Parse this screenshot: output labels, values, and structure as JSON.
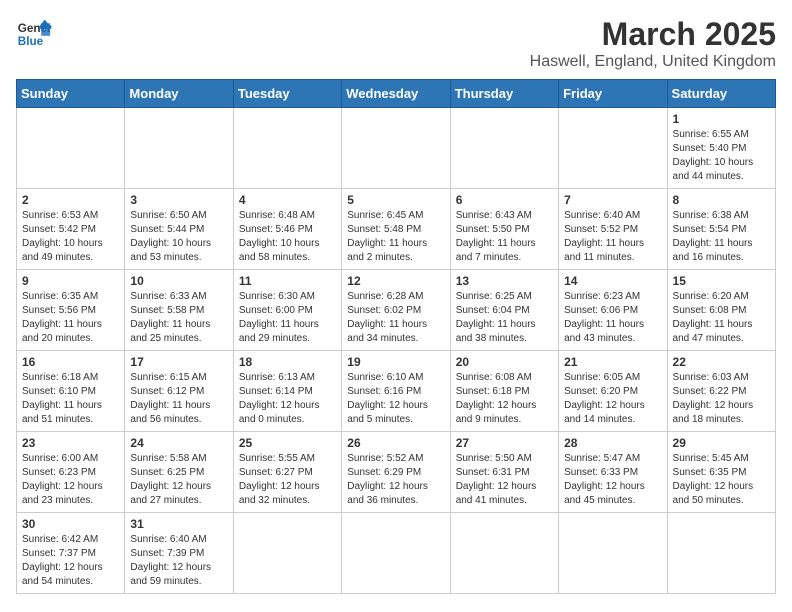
{
  "header": {
    "logo_line1": "General",
    "logo_line2": "Blue",
    "title": "March 2025",
    "subtitle": "Haswell, England, United Kingdom"
  },
  "weekdays": [
    "Sunday",
    "Monday",
    "Tuesday",
    "Wednesday",
    "Thursday",
    "Friday",
    "Saturday"
  ],
  "weeks": [
    [
      {
        "day": "",
        "info": ""
      },
      {
        "day": "",
        "info": ""
      },
      {
        "day": "",
        "info": ""
      },
      {
        "day": "",
        "info": ""
      },
      {
        "day": "",
        "info": ""
      },
      {
        "day": "",
        "info": ""
      },
      {
        "day": "1",
        "info": "Sunrise: 6:55 AM\nSunset: 5:40 PM\nDaylight: 10 hours\nand 44 minutes."
      }
    ],
    [
      {
        "day": "2",
        "info": "Sunrise: 6:53 AM\nSunset: 5:42 PM\nDaylight: 10 hours\nand 49 minutes."
      },
      {
        "day": "3",
        "info": "Sunrise: 6:50 AM\nSunset: 5:44 PM\nDaylight: 10 hours\nand 53 minutes."
      },
      {
        "day": "4",
        "info": "Sunrise: 6:48 AM\nSunset: 5:46 PM\nDaylight: 10 hours\nand 58 minutes."
      },
      {
        "day": "5",
        "info": "Sunrise: 6:45 AM\nSunset: 5:48 PM\nDaylight: 11 hours\nand 2 minutes."
      },
      {
        "day": "6",
        "info": "Sunrise: 6:43 AM\nSunset: 5:50 PM\nDaylight: 11 hours\nand 7 minutes."
      },
      {
        "day": "7",
        "info": "Sunrise: 6:40 AM\nSunset: 5:52 PM\nDaylight: 11 hours\nand 11 minutes."
      },
      {
        "day": "8",
        "info": "Sunrise: 6:38 AM\nSunset: 5:54 PM\nDaylight: 11 hours\nand 16 minutes."
      }
    ],
    [
      {
        "day": "9",
        "info": "Sunrise: 6:35 AM\nSunset: 5:56 PM\nDaylight: 11 hours\nand 20 minutes."
      },
      {
        "day": "10",
        "info": "Sunrise: 6:33 AM\nSunset: 5:58 PM\nDaylight: 11 hours\nand 25 minutes."
      },
      {
        "day": "11",
        "info": "Sunrise: 6:30 AM\nSunset: 6:00 PM\nDaylight: 11 hours\nand 29 minutes."
      },
      {
        "day": "12",
        "info": "Sunrise: 6:28 AM\nSunset: 6:02 PM\nDaylight: 11 hours\nand 34 minutes."
      },
      {
        "day": "13",
        "info": "Sunrise: 6:25 AM\nSunset: 6:04 PM\nDaylight: 11 hours\nand 38 minutes."
      },
      {
        "day": "14",
        "info": "Sunrise: 6:23 AM\nSunset: 6:06 PM\nDaylight: 11 hours\nand 43 minutes."
      },
      {
        "day": "15",
        "info": "Sunrise: 6:20 AM\nSunset: 6:08 PM\nDaylight: 11 hours\nand 47 minutes."
      }
    ],
    [
      {
        "day": "16",
        "info": "Sunrise: 6:18 AM\nSunset: 6:10 PM\nDaylight: 11 hours\nand 51 minutes."
      },
      {
        "day": "17",
        "info": "Sunrise: 6:15 AM\nSunset: 6:12 PM\nDaylight: 11 hours\nand 56 minutes."
      },
      {
        "day": "18",
        "info": "Sunrise: 6:13 AM\nSunset: 6:14 PM\nDaylight: 12 hours\nand 0 minutes."
      },
      {
        "day": "19",
        "info": "Sunrise: 6:10 AM\nSunset: 6:16 PM\nDaylight: 12 hours\nand 5 minutes."
      },
      {
        "day": "20",
        "info": "Sunrise: 6:08 AM\nSunset: 6:18 PM\nDaylight: 12 hours\nand 9 minutes."
      },
      {
        "day": "21",
        "info": "Sunrise: 6:05 AM\nSunset: 6:20 PM\nDaylight: 12 hours\nand 14 minutes."
      },
      {
        "day": "22",
        "info": "Sunrise: 6:03 AM\nSunset: 6:22 PM\nDaylight: 12 hours\nand 18 minutes."
      }
    ],
    [
      {
        "day": "23",
        "info": "Sunrise: 6:00 AM\nSunset: 6:23 PM\nDaylight: 12 hours\nand 23 minutes."
      },
      {
        "day": "24",
        "info": "Sunrise: 5:58 AM\nSunset: 6:25 PM\nDaylight: 12 hours\nand 27 minutes."
      },
      {
        "day": "25",
        "info": "Sunrise: 5:55 AM\nSunset: 6:27 PM\nDaylight: 12 hours\nand 32 minutes."
      },
      {
        "day": "26",
        "info": "Sunrise: 5:52 AM\nSunset: 6:29 PM\nDaylight: 12 hours\nand 36 minutes."
      },
      {
        "day": "27",
        "info": "Sunrise: 5:50 AM\nSunset: 6:31 PM\nDaylight: 12 hours\nand 41 minutes."
      },
      {
        "day": "28",
        "info": "Sunrise: 5:47 AM\nSunset: 6:33 PM\nDaylight: 12 hours\nand 45 minutes."
      },
      {
        "day": "29",
        "info": "Sunrise: 5:45 AM\nSunset: 6:35 PM\nDaylight: 12 hours\nand 50 minutes."
      }
    ],
    [
      {
        "day": "30",
        "info": "Sunrise: 6:42 AM\nSunset: 7:37 PM\nDaylight: 12 hours\nand 54 minutes."
      },
      {
        "day": "31",
        "info": "Sunrise: 6:40 AM\nSunset: 7:39 PM\nDaylight: 12 hours\nand 59 minutes."
      },
      {
        "day": "",
        "info": ""
      },
      {
        "day": "",
        "info": ""
      },
      {
        "day": "",
        "info": ""
      },
      {
        "day": "",
        "info": ""
      },
      {
        "day": "",
        "info": ""
      }
    ]
  ]
}
